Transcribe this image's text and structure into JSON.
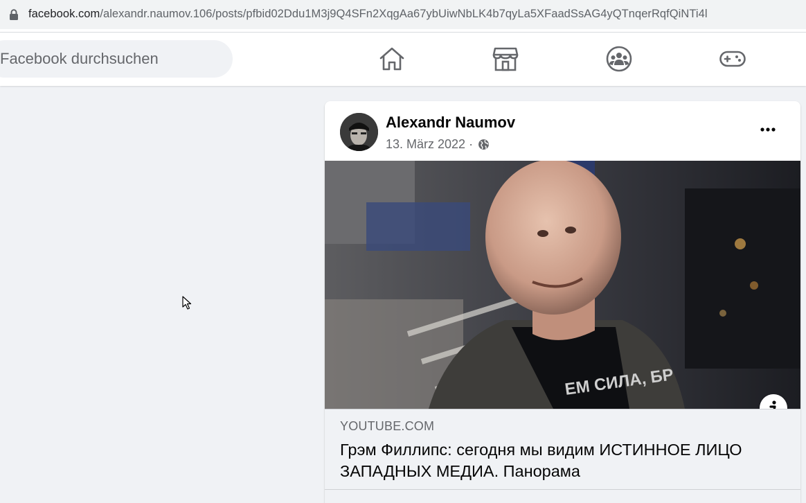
{
  "browser": {
    "url_host": "facebook.com",
    "url_path": "/alexandr.naumov.106/posts/pfbid02Ddu1M3j9Q4SFn2XqgAa67ybUiwNbLK4b7qyLa5XFaadSsAG4yQTnqerRqfQiNTi4l",
    "lock_icon": "lock-icon"
  },
  "topnav": {
    "search_placeholder": "Facebook durchsuchen",
    "icons": [
      "home-icon",
      "marketplace-icon",
      "groups-icon",
      "gaming-icon"
    ]
  },
  "post": {
    "author": "Alexandr Naumov",
    "date": "13. März 2022",
    "separator": " · ",
    "privacy_icon": "globe-icon",
    "more_icon": "more-options-icon",
    "link": {
      "domain": "YOUTUBE.COM",
      "title": "Грэм Филлипс: сегодня мы видим ИСТИННОЕ ЛИЦО ЗАПАДНЫХ МЕДИА. Панорама",
      "info_icon": "info-icon",
      "shirt_text": "ЕМ СИЛА, БР"
    }
  }
}
